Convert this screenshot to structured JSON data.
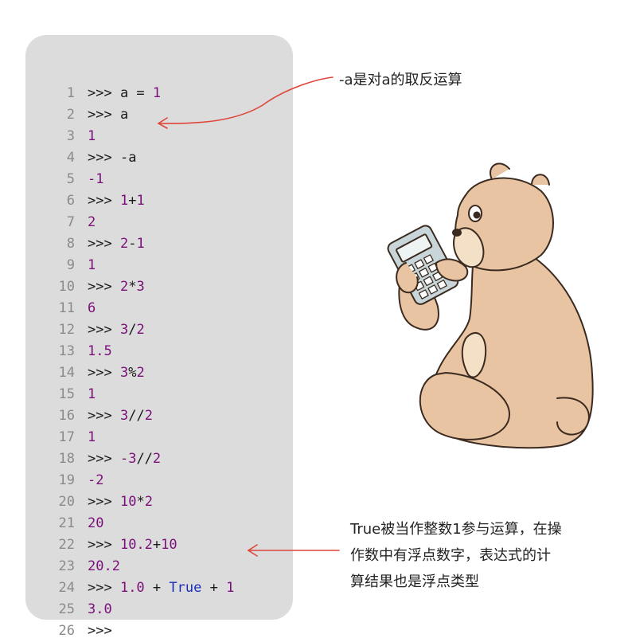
{
  "code": {
    "lines": [
      {
        "no": "1",
        "tokens": [
          {
            "t": ">>> ",
            "c": "op"
          },
          {
            "t": "a = ",
            "c": "op"
          },
          {
            "t": "1",
            "c": "num"
          }
        ]
      },
      {
        "no": "2",
        "tokens": [
          {
            "t": ">>> ",
            "c": "op"
          },
          {
            "t": "a",
            "c": "op"
          }
        ]
      },
      {
        "no": "3",
        "tokens": [
          {
            "t": "1",
            "c": "num"
          }
        ]
      },
      {
        "no": "4",
        "tokens": [
          {
            "t": ">>> ",
            "c": "op"
          },
          {
            "t": "-a",
            "c": "op"
          }
        ]
      },
      {
        "no": "5",
        "tokens": [
          {
            "t": "-1",
            "c": "num"
          }
        ]
      },
      {
        "no": "6",
        "tokens": [
          {
            "t": ">>> ",
            "c": "op"
          },
          {
            "t": "1",
            "c": "num"
          },
          {
            "t": "+",
            "c": "op"
          },
          {
            "t": "1",
            "c": "num"
          }
        ]
      },
      {
        "no": "7",
        "tokens": [
          {
            "t": "2",
            "c": "num"
          }
        ]
      },
      {
        "no": "8",
        "tokens": [
          {
            "t": ">>> ",
            "c": "op"
          },
          {
            "t": "2",
            "c": "num"
          },
          {
            "t": "-",
            "c": "op"
          },
          {
            "t": "1",
            "c": "num"
          }
        ]
      },
      {
        "no": "9",
        "tokens": [
          {
            "t": "1",
            "c": "num"
          }
        ]
      },
      {
        "no": "10",
        "tokens": [
          {
            "t": ">>> ",
            "c": "op"
          },
          {
            "t": "2",
            "c": "num"
          },
          {
            "t": "*",
            "c": "op"
          },
          {
            "t": "3",
            "c": "num"
          }
        ]
      },
      {
        "no": "11",
        "tokens": [
          {
            "t": "6",
            "c": "num"
          }
        ]
      },
      {
        "no": "12",
        "tokens": [
          {
            "t": ">>> ",
            "c": "op"
          },
          {
            "t": "3",
            "c": "num"
          },
          {
            "t": "/",
            "c": "op"
          },
          {
            "t": "2",
            "c": "num"
          }
        ]
      },
      {
        "no": "13",
        "tokens": [
          {
            "t": "1.5",
            "c": "num"
          }
        ]
      },
      {
        "no": "14",
        "tokens": [
          {
            "t": ">>> ",
            "c": "op"
          },
          {
            "t": "3",
            "c": "num"
          },
          {
            "t": "%",
            "c": "op"
          },
          {
            "t": "2",
            "c": "num"
          }
        ]
      },
      {
        "no": "15",
        "tokens": [
          {
            "t": "1",
            "c": "num"
          }
        ]
      },
      {
        "no": "16",
        "tokens": [
          {
            "t": ">>> ",
            "c": "op"
          },
          {
            "t": "3",
            "c": "num"
          },
          {
            "t": "//",
            "c": "op"
          },
          {
            "t": "2",
            "c": "num"
          }
        ]
      },
      {
        "no": "17",
        "tokens": [
          {
            "t": "1",
            "c": "num"
          }
        ]
      },
      {
        "no": "18",
        "tokens": [
          {
            "t": ">>> ",
            "c": "op"
          },
          {
            "t": "-3",
            "c": "num"
          },
          {
            "t": "//",
            "c": "op"
          },
          {
            "t": "2",
            "c": "num"
          }
        ]
      },
      {
        "no": "19",
        "tokens": [
          {
            "t": "-2",
            "c": "num"
          }
        ]
      },
      {
        "no": "20",
        "tokens": [
          {
            "t": ">>> ",
            "c": "op"
          },
          {
            "t": "10",
            "c": "num"
          },
          {
            "t": "*",
            "c": "op"
          },
          {
            "t": "2",
            "c": "num"
          }
        ]
      },
      {
        "no": "21",
        "tokens": [
          {
            "t": "20",
            "c": "num"
          }
        ]
      },
      {
        "no": "22",
        "tokens": [
          {
            "t": ">>> ",
            "c": "op"
          },
          {
            "t": "10.2",
            "c": "num"
          },
          {
            "t": "+",
            "c": "op"
          },
          {
            "t": "10",
            "c": "num"
          }
        ]
      },
      {
        "no": "23",
        "tokens": [
          {
            "t": "20.2",
            "c": "num"
          }
        ]
      },
      {
        "no": "24",
        "tokens": [
          {
            "t": ">>> ",
            "c": "op"
          },
          {
            "t": "1.0",
            "c": "num"
          },
          {
            "t": " + ",
            "c": "op"
          },
          {
            "t": "True",
            "c": "kw"
          },
          {
            "t": " + ",
            "c": "op"
          },
          {
            "t": "1",
            "c": "num"
          }
        ]
      },
      {
        "no": "25",
        "tokens": [
          {
            "t": "3.0",
            "c": "num"
          }
        ]
      },
      {
        "no": "26",
        "tokens": [
          {
            "t": ">>>",
            "c": "op"
          }
        ]
      }
    ]
  },
  "annotations": {
    "negation_note": "-a是对a的取反运算",
    "true_note": {
      "line1": "True被当作整数1参与运算，在操",
      "line2": "作数中有浮点数字，表达式的计",
      "line3": "算结果也是浮点类型"
    }
  },
  "colors": {
    "panel_bg": "#dcdcdc",
    "number_purple": "#7a0f7a",
    "keyword_blue": "#1a2fb8",
    "arrow_red": "#e0453a",
    "bear_fur": "#e9c4a2",
    "bear_outline": "#3a2a20"
  },
  "icons": {
    "illustration": "bear-with-calculator-icon",
    "arrow": "arrow-left-icon"
  }
}
